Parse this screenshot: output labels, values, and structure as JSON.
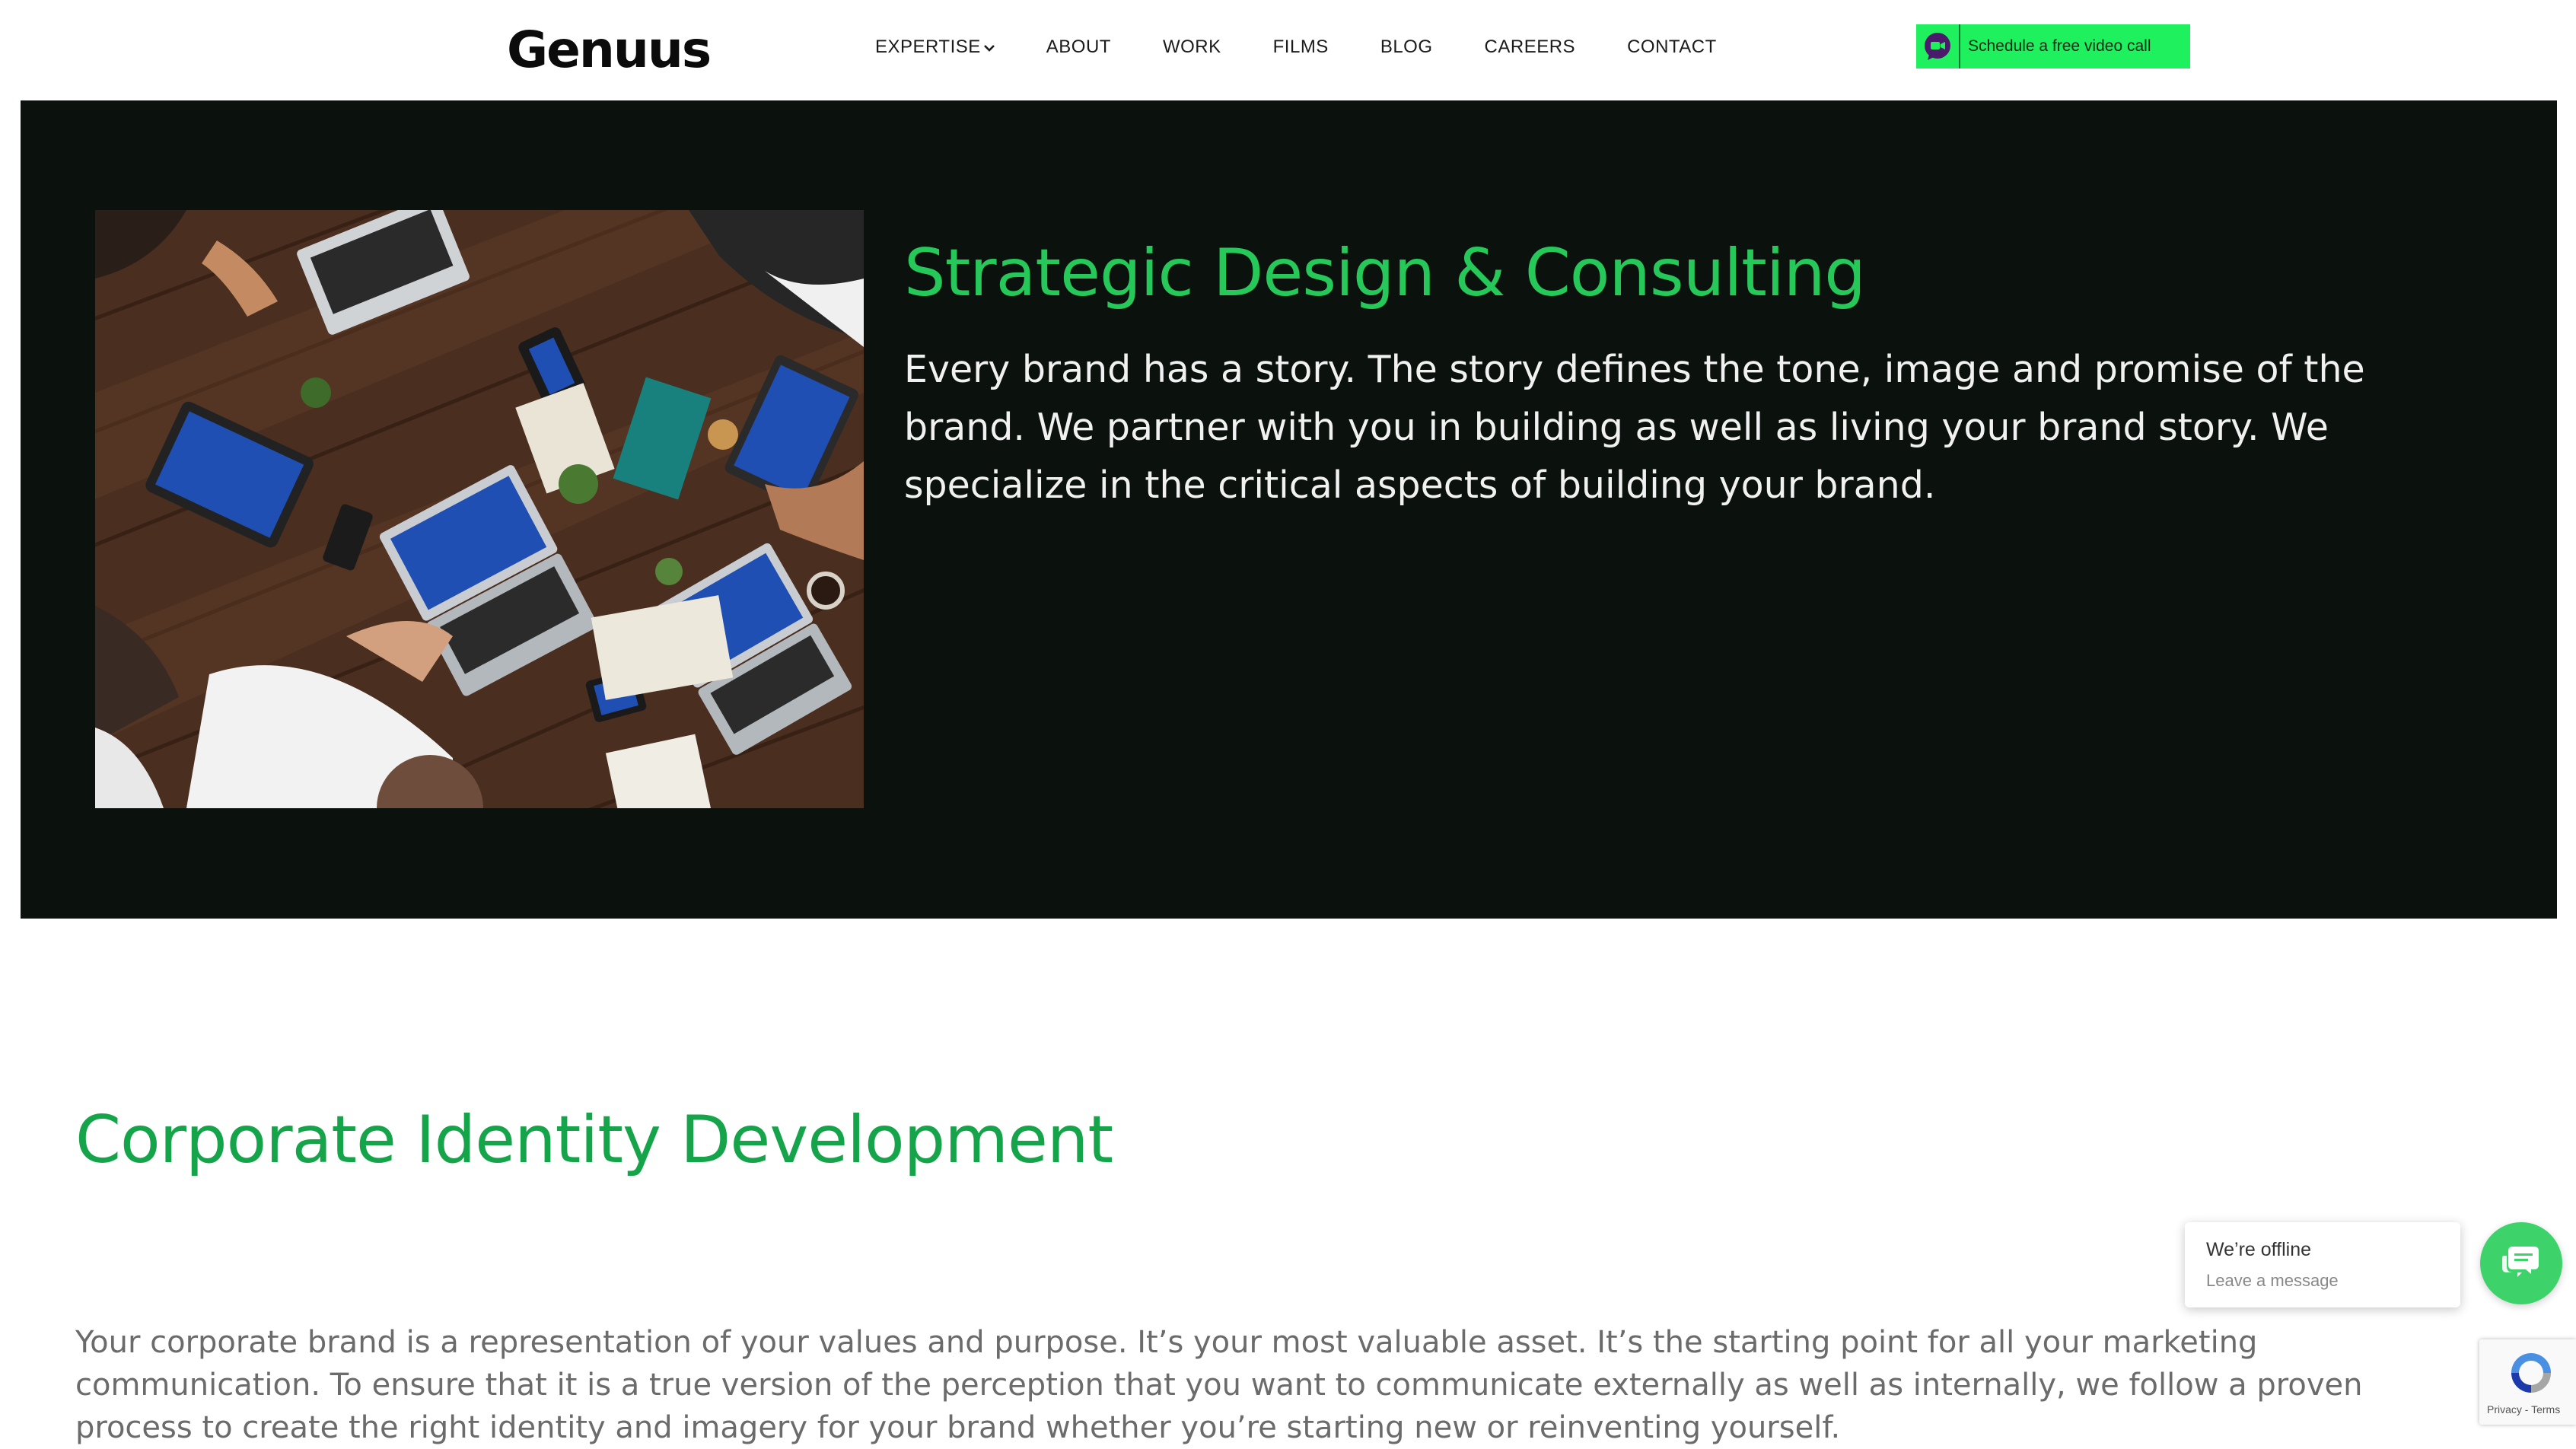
{
  "header": {
    "logo": "Genuus",
    "nav": [
      {
        "label": "EXPERTISE",
        "has_dropdown": true
      },
      {
        "label": "ABOUT"
      },
      {
        "label": "WORK"
      },
      {
        "label": "FILMS"
      },
      {
        "label": "BLOG"
      },
      {
        "label": "CAREERS"
      },
      {
        "label": "CONTACT"
      }
    ],
    "cta": {
      "label": "Schedule a free video call",
      "icon": "video-chat-icon",
      "color": "#1ef05e"
    }
  },
  "hero": {
    "title": "Strategic Design & Consulting",
    "text": "Every brand has a story. The story defines the tone, image and promise of the brand. We partner with you in building as well as living your brand story. We specialize in the critical aspects of building your brand.",
    "image": "team-meeting-photo",
    "background": "#0b120e",
    "title_color": "#27c85a"
  },
  "section": {
    "title": "Corporate Identity Development",
    "text": "Your corporate brand is a representation of your values and purpose. It’s your most valuable asset. It’s the starting point for all your marketing communication. To ensure that it is a true version of the perception that you want to communicate externally as well as internally, we follow a proven process to create the right identity and imagery for your brand whether you’re starting new or reinventing yourself.",
    "title_color": "#16a44a"
  },
  "chat": {
    "status": "We’re offline",
    "sub": "Leave a message",
    "icon": "chat-bubble-icon",
    "color": "#3ed36a"
  },
  "recaptcha": {
    "links": "Privacy - Terms",
    "icon": "recaptcha-icon"
  }
}
